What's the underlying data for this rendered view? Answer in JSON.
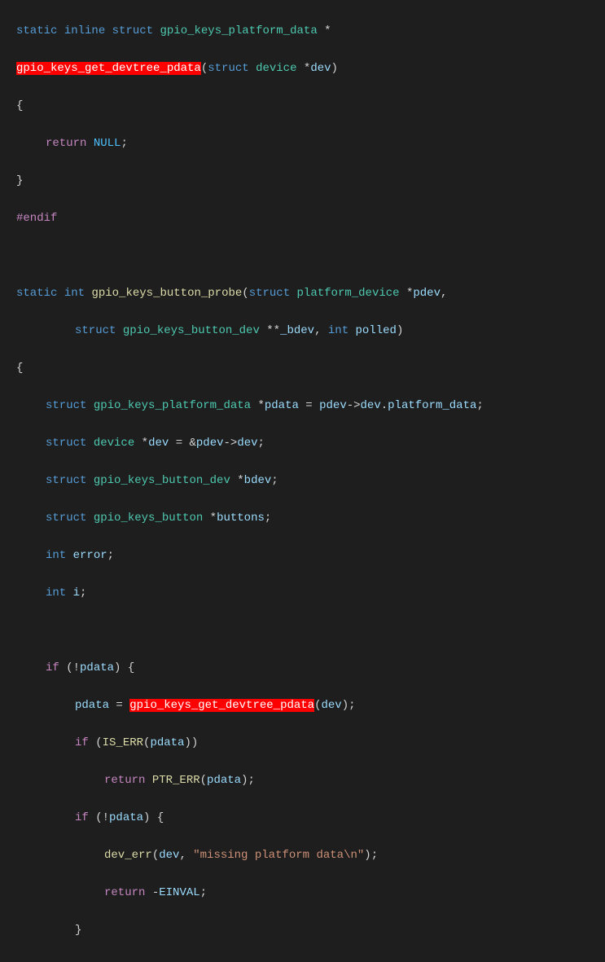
{
  "code": {
    "line1_kw1": "static",
    "line1_kw2": "inline",
    "line1_kw3": "struct",
    "line1_type": "gpio_keys_platform_data",
    "line1_op": "*",
    "line2_func_hl": "gpio_keys_get_devtree_pdata",
    "line2_paren_open": "(",
    "line2_kw": "struct",
    "line2_type": "device",
    "line2_op": "*",
    "line2_var": "dev",
    "line2_paren_close": ")",
    "line3_brace": "{",
    "line4_return": "return",
    "line4_null": "NULL",
    "line4_semi": ";",
    "line5_brace": "}",
    "line6_endif": "#endif",
    "line8_kw1": "static",
    "line8_kw2": "int",
    "line8_func": "gpio_keys_button_probe",
    "line8_paren_open": "(",
    "line8_kw3": "struct",
    "line8_type": "platform_device",
    "line8_op": "*",
    "line8_var": "pdev",
    "line8_comma": ",",
    "line9_kw1": "struct",
    "line9_type": "gpio_keys_button_dev",
    "line9_op": "**",
    "line9_var": "_bdev",
    "line9_comma": ",",
    "line9_kw2": "int",
    "line9_var2": "polled",
    "line9_paren_close": ")",
    "line10_brace": "{",
    "line11_kw": "struct",
    "line11_type": "gpio_keys_platform_data",
    "line11_op1": "*",
    "line11_var1": "pdata",
    "line11_eq": "=",
    "line11_var2": "pdev",
    "line11_arrow": "->",
    "line11_var3": "dev",
    "line11_dot": ".",
    "line11_var4": "platform_data",
    "line11_semi": ";",
    "line12_kw": "struct",
    "line12_type": "device",
    "line12_op": "*",
    "line12_var1": "dev",
    "line12_eq": "=",
    "line12_amp": "&",
    "line12_var2": "pdev",
    "line12_arrow": "->",
    "line12_var3": "dev",
    "line12_semi": ";",
    "line13_kw": "struct",
    "line13_type": "gpio_keys_button_dev",
    "line13_op": "*",
    "line13_var": "bdev",
    "line13_semi": ";",
    "line14_kw": "struct",
    "line14_type": "gpio_keys_button",
    "line14_op": "*",
    "line14_var": "buttons",
    "line14_semi": ";",
    "line15_kw": "int",
    "line15_var": "error",
    "line15_semi": ";",
    "line16_kw": "int",
    "line16_var": "i",
    "line16_semi": ";",
    "line18_if": "if",
    "line18_open": "(",
    "line18_bang": "!",
    "line18_var": "pdata",
    "line18_close": ")",
    "line18_brace": "{",
    "line19_var1": "pdata",
    "line19_eq": "=",
    "line19_func_hl": "gpio_keys_get_devtree_pdata",
    "line19_open": "(",
    "line19_var2": "dev",
    "line19_close": ")",
    "line19_semi": ";",
    "line20_if": "if",
    "line20_open": "(",
    "line20_func": "IS_ERR",
    "line20_open2": "(",
    "line20_var": "pdata",
    "line20_close": "))",
    "line21_return": "return",
    "line21_func": "PTR_ERR",
    "line21_open": "(",
    "line21_var": "pdata",
    "line21_close": ")",
    "line21_semi": ";",
    "line22_if": "if",
    "line22_open": "(",
    "line22_bang": "!",
    "line22_var": "pdata",
    "line22_close": ")",
    "line22_brace": "{",
    "line23_func": "dev_err",
    "line23_open": "(",
    "line23_var": "dev",
    "line23_comma": ",",
    "line23_str": "\"missing platform data\\n\"",
    "line23_close": ")",
    "line23_semi": ";",
    "line24_return": "return",
    "line24_minus": "-",
    "line24_const": "EINVAL",
    "line24_semi": ";",
    "line25_brace": "}"
  }
}
